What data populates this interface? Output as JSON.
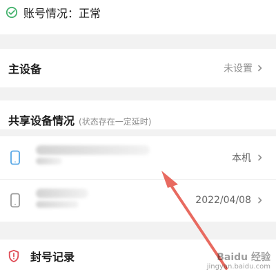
{
  "status": {
    "label": "账号情况：正常",
    "icon": "check-circle-icon",
    "color": "#44b26d"
  },
  "main_device": {
    "title": "主设备",
    "value": "未设置"
  },
  "shared_devices": {
    "title": "共享设备情况",
    "subtitle": "(状态存在一定延时)",
    "items": [
      {
        "right_text": "本机"
      },
      {
        "right_text": "2022/04/08"
      }
    ]
  },
  "ban": {
    "label": "封号记录",
    "icon": "shield-alert-icon",
    "color": "#e04e57"
  },
  "watermark": {
    "line1": "Baidu 经验",
    "line2": "jingyan.baidu.com"
  }
}
